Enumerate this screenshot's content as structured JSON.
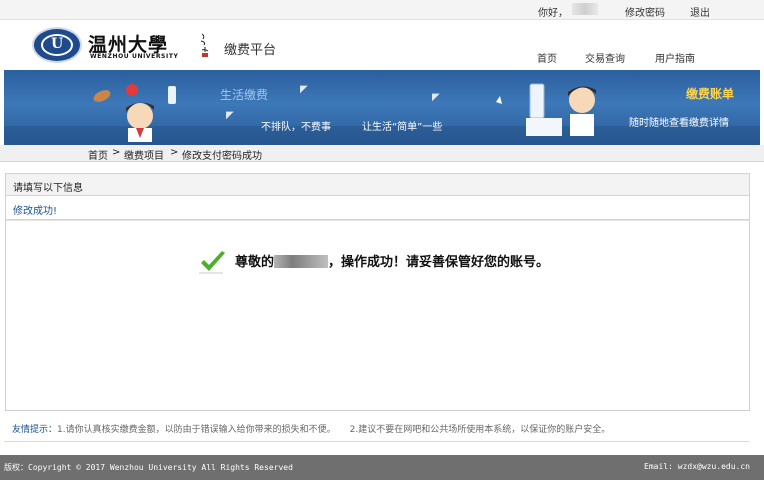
{
  "topbar": {
    "greeting": "你好，",
    "change_password": "修改密码",
    "logout": "退出"
  },
  "header": {
    "university_cn": "温州大學",
    "university_en": "WENZHOU UNIVERSITY",
    "platform": "缴费平台",
    "nav": [
      "首页",
      "交易查询",
      "用户指南"
    ]
  },
  "banner": {
    "left_title": "生活缴费",
    "slogan_left": "不排队，不费事",
    "slogan_mid": "让生活“简单”一些",
    "right_title": "缴费账单",
    "right_sub": "随时随地查看缴费详情"
  },
  "breadcrumb": {
    "home": "首页",
    "sep": ">",
    "item": "缴费项目",
    "current": "修改支付密码成功"
  },
  "panel": {
    "heading": "请填写以下信息",
    "status": "修改成功!"
  },
  "message": {
    "prefix": "尊敬的",
    "suffix": "，操作成功！请妥善保管好您的账号。"
  },
  "tips": {
    "label": "友情提示：",
    "tip1": "1.请你认真核实缴费金额，以防由于错误输入给你带来的损失和不便。",
    "tip2": "2.建议不要在网吧和公共场所使用本系统，以保证你的账户安全。"
  },
  "footer": {
    "copyright": "版权：Copyright © 2017 Wenzhou University All Rights Reserved",
    "email": "Email: wzdx@wzu.edu.cn"
  },
  "colors": {
    "banner_blue": "#2b5f9e",
    "link_blue": "#1a4f8f",
    "accent_yellow": "#ffd24a",
    "success_green": "#4caf28",
    "footer_gray": "#6f6f6f"
  }
}
